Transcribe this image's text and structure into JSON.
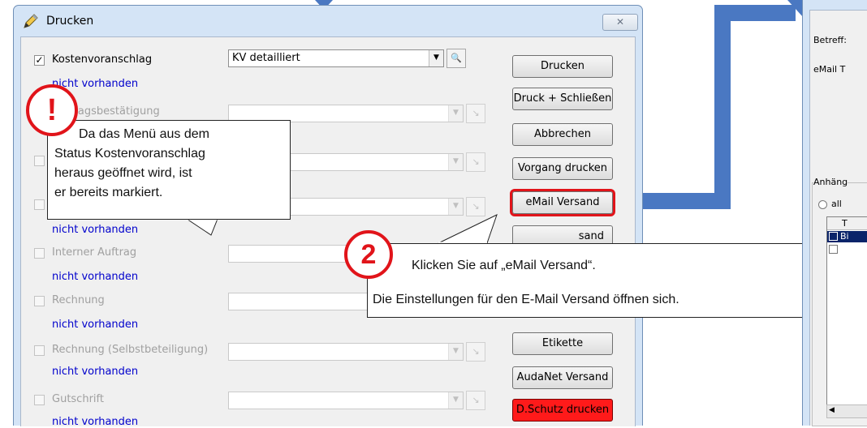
{
  "dialog": {
    "title": "Drucken",
    "close_glyph": "✕"
  },
  "rows": [
    {
      "label": "Kostenvoranschlag",
      "checked": true,
      "status": "nicht vorhanden",
      "combo_value": "KV detailliert"
    },
    {
      "label": "Auftragsbestätigung",
      "checked": false,
      "status": "",
      "combo_value": ""
    },
    {
      "label": "",
      "checked": false,
      "status": "",
      "combo_value": ""
    },
    {
      "label": "",
      "checked": false,
      "status": "nicht vorhanden",
      "combo_value": ""
    },
    {
      "label": "Interner Auftrag",
      "checked": false,
      "status": "nicht vorhanden",
      "combo_value": ""
    },
    {
      "label": "Rechnung",
      "checked": false,
      "status": "nicht vorhanden",
      "combo_value": ""
    },
    {
      "label": "Rechnung (Selbstbeteiligung)",
      "checked": false,
      "status": "nicht vorhanden",
      "combo_value": ""
    },
    {
      "label": "Gutschrift",
      "checked": false,
      "status": "nicht vorhanden",
      "combo_value": ""
    }
  ],
  "buttons": {
    "drucken": "Drucken",
    "druck_schliessen": "Druck + Schließen",
    "abbrechen": "Abbrechen",
    "vorgang_drucken": "Vorgang drucken",
    "email_versand": "eMail Versand",
    "partial_versand": "sand",
    "etikette": "Etikette",
    "audanet_versand": "AudaNet Versand",
    "dschutz_drucken": "D.Schutz drucken"
  },
  "callout1": {
    "badge": "!",
    "text_lines": [
      "Da das Menü aus dem",
      "Status Kostenvoranschlag",
      "heraus geöffnet wird, ist",
      "er bereits markiert."
    ]
  },
  "callout2": {
    "badge": "2",
    "line1": "Klicken Sie auf „eMail Versand“.",
    "line2": "Die Einstellungen für den E-Mail Versand öffnen sich."
  },
  "second_window": {
    "betreff_label": "Betreff:",
    "email_label": "eMail T",
    "anhang_label": "Anhäng",
    "alle_label": "all",
    "col_header": "T",
    "row_text": "Bi"
  },
  "colors": {
    "accent_red": "#e1141a",
    "arrow_blue": "#4a78c2",
    "status_blue": "#0000cc"
  }
}
